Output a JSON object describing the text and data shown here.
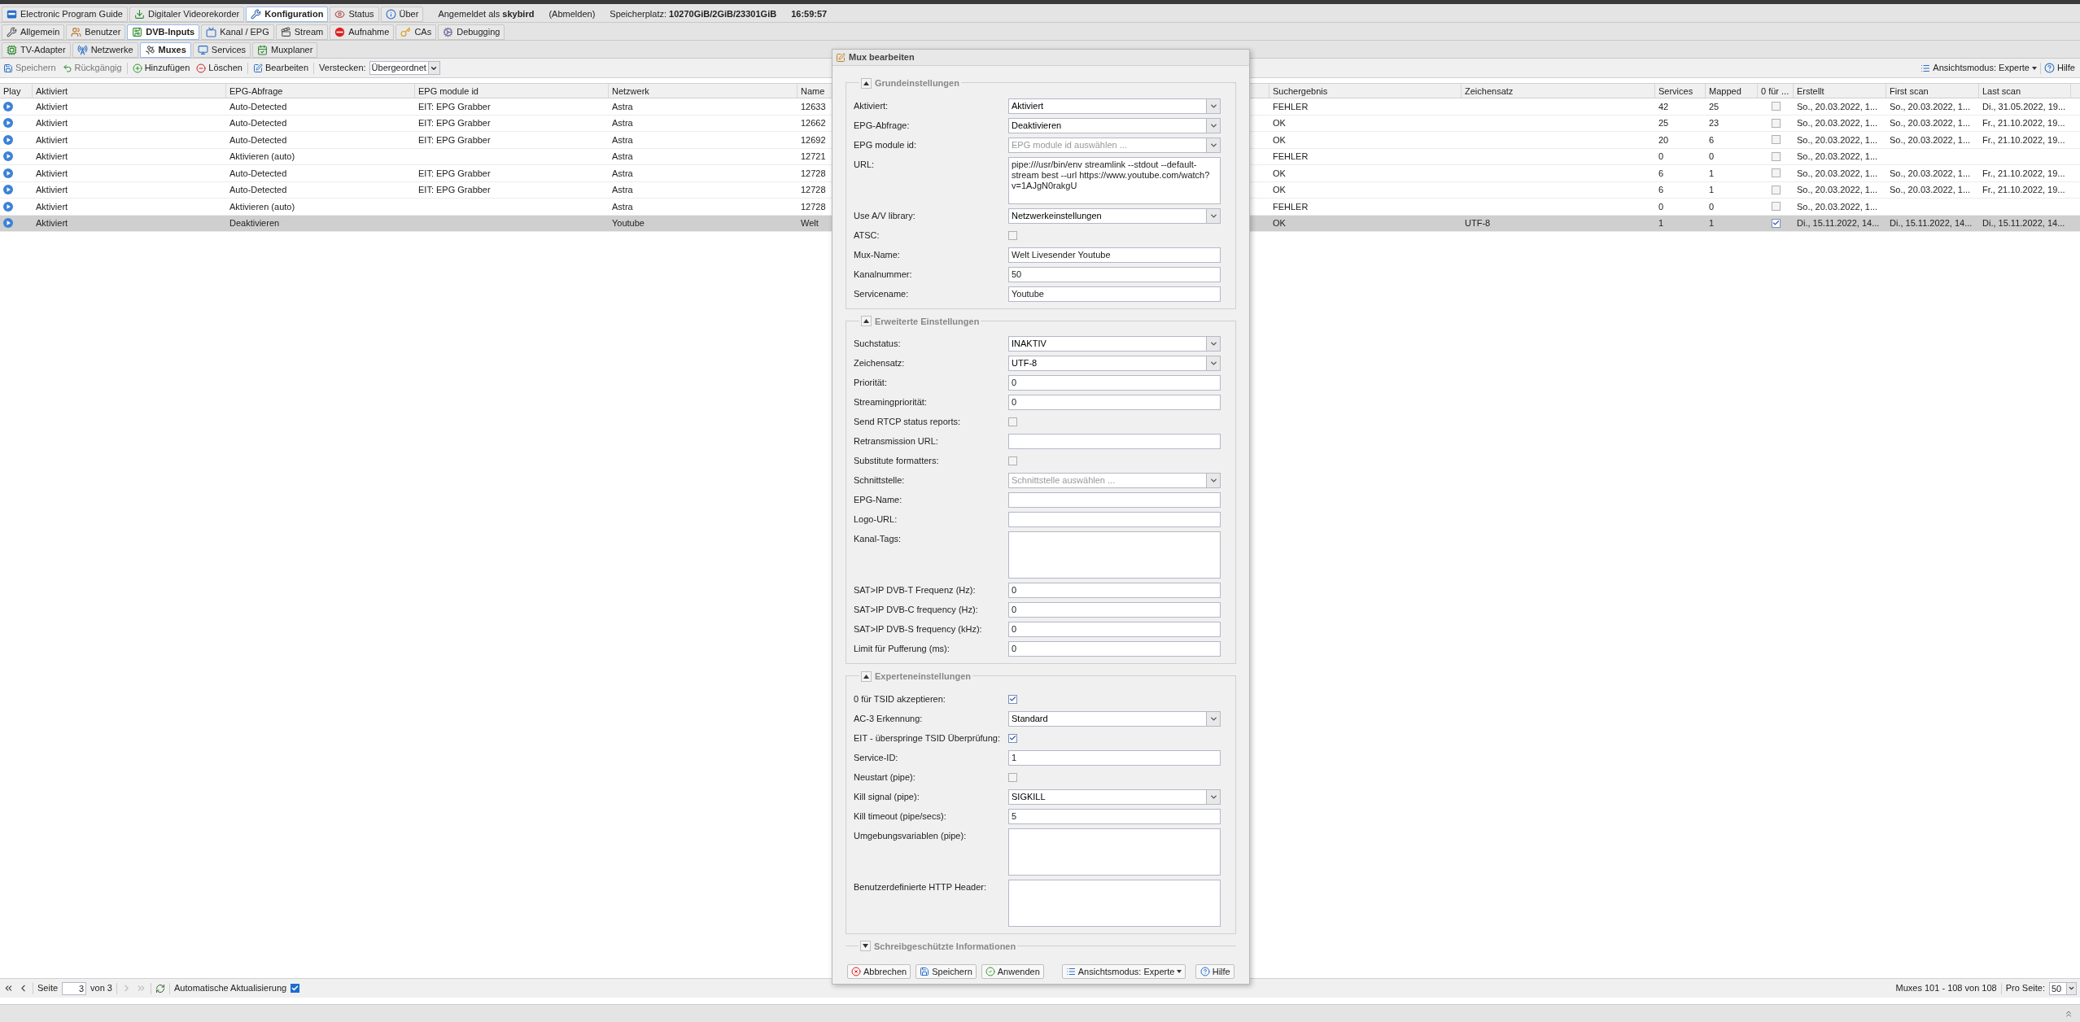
{
  "main_tabs": [
    {
      "label": "Electronic Program Guide",
      "selected": false
    },
    {
      "label": "Digitaler Videorekorder",
      "selected": false
    },
    {
      "label": "Konfiguration",
      "selected": true
    },
    {
      "label": "Status",
      "selected": false
    },
    {
      "label": "Über",
      "selected": false
    }
  ],
  "session": {
    "user": "Angemeldet als **skybird**",
    "logout": "(Abmelden)",
    "storage": "Speicherplatz: **10270GiB/2GiB/23301GiB**",
    "time": "16:59:57"
  },
  "config_tabs": [
    {
      "label": "Allgemein",
      "selected": false
    },
    {
      "label": "Benutzer",
      "selected": false
    },
    {
      "label": "DVB-Inputs",
      "selected": true
    },
    {
      "label": "Kanal / EPG",
      "selected": false
    },
    {
      "label": "Stream",
      "selected": false
    },
    {
      "label": "Aufnahme",
      "selected": false
    },
    {
      "label": "CAs",
      "selected": false
    },
    {
      "label": "Debugging",
      "selected": false
    }
  ],
  "dvb_tabs": [
    {
      "label": "TV-Adapter",
      "selected": false
    },
    {
      "label": "Netzwerke",
      "selected": false
    },
    {
      "label": "Muxes",
      "selected": true
    },
    {
      "label": "Services",
      "selected": false
    },
    {
      "label": "Muxplaner",
      "selected": false
    }
  ],
  "toolbar": {
    "buttons": [
      {
        "label": "Speichern",
        "disabled": true
      },
      {
        "label": "Rückgängig",
        "disabled": true
      },
      {
        "label": "Hinzufügen",
        "disabled": false
      },
      {
        "label": "Löschen",
        "disabled": false
      },
      {
        "label": "Bearbeiten",
        "disabled": false
      }
    ],
    "hide_label": "Verstecken:",
    "hide_value": "Übergeordnet",
    "view_mode": "Ansichtsmodus: Experte",
    "help": "Hilfe"
  },
  "table": {
    "columns": [
      "Play",
      "Aktiviert",
      "EPG-Abfrage",
      "EPG module id",
      "Netzwerk",
      "Name",
      "Suchergebnis",
      "Zeichensatz",
      "Services",
      "Mapped",
      "0 für ...",
      "Erstellt",
      "First scan",
      "Last scan"
    ],
    "rows": [
      {
        "selected": false,
        "aktiviert": "Aktiviert",
        "epg": "Auto-Detected",
        "epg_module": "EIT: EPG Grabber",
        "network": "Astra",
        "name": "12633",
        "scan_result": "FEHLER",
        "charset": "",
        "services": "42",
        "mapped": "25",
        "tsid_zero": false,
        "created": "So., 20.03.2022, 1...",
        "first_scan": "So., 20.03.2022, 1...",
        "last_scan": "Di., 31.05.2022, 19..."
      },
      {
        "selected": false,
        "aktiviert": "Aktiviert",
        "epg": "Auto-Detected",
        "epg_module": "EIT: EPG Grabber",
        "network": "Astra",
        "name": "12662",
        "scan_result": "OK",
        "charset": "",
        "services": "25",
        "mapped": "23",
        "tsid_zero": false,
        "created": "So., 20.03.2022, 1...",
        "first_scan": "So., 20.03.2022, 1...",
        "last_scan": "Fr., 21.10.2022, 19..."
      },
      {
        "selected": false,
        "aktiviert": "Aktiviert",
        "epg": "Auto-Detected",
        "epg_module": "EIT: EPG Grabber",
        "network": "Astra",
        "name": "12692",
        "scan_result": "OK",
        "charset": "",
        "services": "20",
        "mapped": "6",
        "tsid_zero": false,
        "created": "So., 20.03.2022, 1...",
        "first_scan": "So., 20.03.2022, 1...",
        "last_scan": "Fr., 21.10.2022, 19..."
      },
      {
        "selected": false,
        "aktiviert": "Aktiviert",
        "epg": "Aktivieren (auto)",
        "epg_module": "",
        "network": "Astra",
        "name": "12721",
        "scan_result": "FEHLER",
        "charset": "",
        "services": "0",
        "mapped": "0",
        "tsid_zero": false,
        "created": "So., 20.03.2022, 1...",
        "first_scan": "",
        "last_scan": ""
      },
      {
        "selected": false,
        "aktiviert": "Aktiviert",
        "epg": "Auto-Detected",
        "epg_module": "EIT: EPG Grabber",
        "network": "Astra",
        "name": "12728",
        "scan_result": "OK",
        "charset": "",
        "services": "6",
        "mapped": "1",
        "tsid_zero": false,
        "created": "So., 20.03.2022, 1...",
        "first_scan": "So., 20.03.2022, 1...",
        "last_scan": "Fr., 21.10.2022, 19..."
      },
      {
        "selected": false,
        "aktiviert": "Aktiviert",
        "epg": "Auto-Detected",
        "epg_module": "EIT: EPG Grabber",
        "network": "Astra",
        "name": "12728",
        "scan_result": "OK",
        "charset": "",
        "services": "6",
        "mapped": "1",
        "tsid_zero": false,
        "created": "So., 20.03.2022, 1...",
        "first_scan": "So., 20.03.2022, 1...",
        "last_scan": "Fr., 21.10.2022, 19..."
      },
      {
        "selected": false,
        "aktiviert": "Aktiviert",
        "epg": "Aktivieren (auto)",
        "epg_module": "",
        "network": "Astra",
        "name": "12728",
        "scan_result": "FEHLER",
        "charset": "",
        "services": "0",
        "mapped": "0",
        "tsid_zero": false,
        "created": "So., 20.03.2022, 1...",
        "first_scan": "",
        "last_scan": ""
      },
      {
        "selected": true,
        "aktiviert": "Aktiviert",
        "epg": "Deaktivieren",
        "epg_module": "",
        "network": "Youtube",
        "name": "Welt",
        "scan_result": "OK",
        "charset": "UTF-8",
        "services": "1",
        "mapped": "1",
        "tsid_zero": true,
        "created": "Di., 15.11.2022, 14...",
        "first_scan": "Di., 15.11.2022, 14...",
        "last_scan": "Di., 15.11.2022, 14..."
      }
    ]
  },
  "dialog": {
    "title": "Mux bearbeiten",
    "sections": [
      {
        "title": "Grundeinstellungen",
        "expanded": true,
        "fields": [
          {
            "label": "Aktiviert:",
            "kind": "select",
            "value": "Aktiviert"
          },
          {
            "label": "EPG-Abfrage:",
            "kind": "select",
            "value": "Deaktivieren"
          },
          {
            "label": "EPG module id:",
            "kind": "select",
            "placeholder": "EPG module id auswählen ..."
          },
          {
            "label": "URL:",
            "kind": "textarea",
            "value": "pipe:///usr/bin/env streamlink --stdout --default-stream best --url https://www.youtube.com/watch?v=1AJgN0rakgU"
          },
          {
            "label": "Use A/V library:",
            "kind": "select",
            "value": "Netzwerkeinstellungen"
          },
          {
            "label": "ATSC:",
            "kind": "checkbox",
            "checked": false
          },
          {
            "label": "Mux-Name:",
            "kind": "text",
            "value": "Welt Livesender Youtube"
          },
          {
            "label": "Kanalnummer:",
            "kind": "text",
            "value": "50"
          },
          {
            "label": "Servicename:",
            "kind": "text",
            "value": "Youtube"
          }
        ]
      },
      {
        "title": "Erweiterte Einstellungen",
        "expanded": true,
        "fields": [
          {
            "label": "Suchstatus:",
            "kind": "select",
            "value": "INAKTIV"
          },
          {
            "label": "Zeichensatz:",
            "kind": "select",
            "value": "UTF-8"
          },
          {
            "label": "Priorität:",
            "kind": "text",
            "value": "0"
          },
          {
            "label": "Streamingpriorität:",
            "kind": "text",
            "value": "0"
          },
          {
            "label": "Send RTCP status reports:",
            "kind": "checkbox",
            "checked": false
          },
          {
            "label": "Retransmission URL:",
            "kind": "text"
          },
          {
            "label": "Substitute formatters:",
            "kind": "checkbox",
            "checked": false
          },
          {
            "label": "Schnittstelle:",
            "kind": "select",
            "placeholder": "Schnittstelle auswählen ..."
          },
          {
            "label": "EPG-Name:",
            "kind": "text"
          },
          {
            "label": "Logo-URL:",
            "kind": "text"
          },
          {
            "label": "Kanal-Tags:",
            "kind": "textarea"
          },
          {
            "label": "SAT>IP DVB-T Frequenz (Hz):",
            "kind": "text",
            "value": "0"
          },
          {
            "label": "SAT>IP DVB-C frequency (Hz):",
            "kind": "text",
            "value": "0"
          },
          {
            "label": "SAT>IP DVB-S frequency (kHz):",
            "kind": "text",
            "value": "0"
          },
          {
            "label": "Limit für Pufferung (ms):",
            "kind": "text",
            "value": "0"
          }
        ]
      },
      {
        "title": "Experteneinstellungen",
        "expanded": true,
        "fields": [
          {
            "label": "0 für TSID akzeptieren:",
            "kind": "checkbox",
            "checked": true
          },
          {
            "label": "AC-3 Erkennung:",
            "kind": "select",
            "value": "Standard"
          },
          {
            "label": "EIT - überspringe TSID Überprüfung:",
            "kind": "checkbox",
            "checked": true
          },
          {
            "label": "Service-ID:",
            "kind": "text",
            "value": "1"
          },
          {
            "label": "Neustart (pipe):",
            "kind": "checkbox",
            "checked": false
          },
          {
            "label": "Kill signal (pipe):",
            "kind": "select",
            "value": "SIGKILL"
          },
          {
            "label": "Kill timeout (pipe/secs):",
            "kind": "text",
            "value": "5"
          },
          {
            "label": "Umgebungsvariablen (pipe):",
            "kind": "textarea"
          },
          {
            "label": "Benutzerdefinierte HTTP Header:",
            "kind": "textarea"
          }
        ]
      },
      {
        "title": "Schreibgeschützte Informationen",
        "expanded": false
      }
    ],
    "buttons": [
      {
        "label": "Abbrechen",
        "dropdown": false
      },
      {
        "label": "Speichern",
        "dropdown": false
      },
      {
        "label": "Anwenden",
        "dropdown": false
      },
      {
        "label": "Ansichtsmodus: Experte",
        "dropdown": true
      },
      {
        "label": "Hilfe",
        "dropdown": false
      }
    ]
  },
  "paging": {
    "first_disabled": false,
    "prev_disabled": false,
    "page_label": "Seite",
    "page": "3",
    "of": "von 3",
    "next_disabled": true,
    "last_disabled": true,
    "auto_refresh_label": "Automatische Aktualisierung",
    "auto_refresh": true,
    "summary": "Muxes 101 - 108 von 108",
    "per_page_label": "Pro Seite:",
    "per_page": "50"
  }
}
